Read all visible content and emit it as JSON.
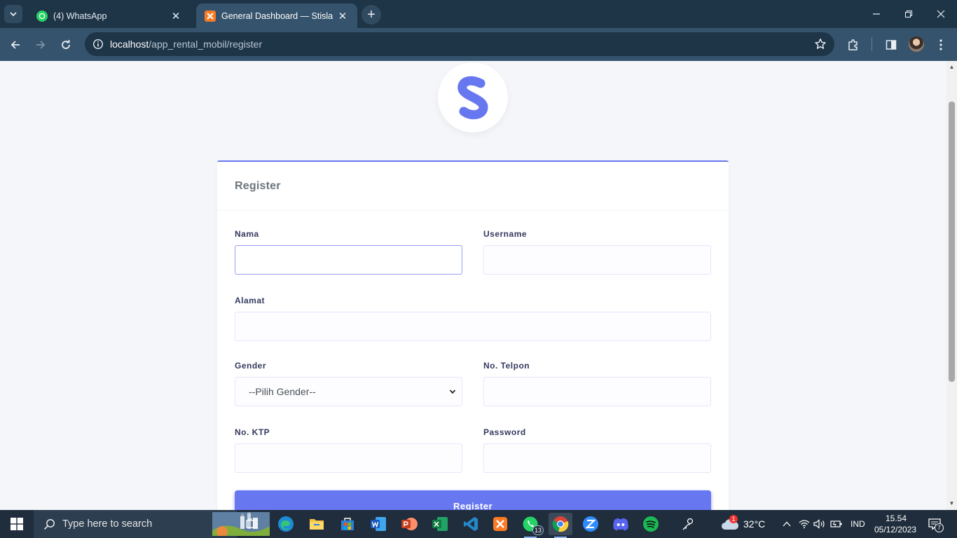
{
  "browser": {
    "tabs": [
      {
        "title": "(4) WhatsApp",
        "favicon": "whatsapp-icon",
        "active": false
      },
      {
        "title": "General Dashboard — Stisla",
        "favicon": "xampp-icon",
        "active": true
      }
    ],
    "address": {
      "host": "localhost",
      "path": "/app_rental_mobil/register"
    }
  },
  "page": {
    "logo_letter": "S",
    "card_title": "Register",
    "form": {
      "nama": {
        "label": "Nama",
        "value": ""
      },
      "username": {
        "label": "Username",
        "value": ""
      },
      "alamat": {
        "label": "Alamat",
        "value": ""
      },
      "gender": {
        "label": "Gender",
        "selected": "--Pilih Gender--"
      },
      "telpon": {
        "label": "No. Telpon",
        "value": ""
      },
      "ktp": {
        "label": "No. KTP",
        "value": ""
      },
      "password": {
        "label": "Password",
        "value": ""
      }
    },
    "submit_label": "Register",
    "accent": "#6777ef"
  },
  "taskbar": {
    "search_placeholder": "Type here to search",
    "apps": [
      {
        "name": "task-view-icon"
      },
      {
        "name": "edge-icon"
      },
      {
        "name": "file-explorer-icon"
      },
      {
        "name": "microsoft-store-icon"
      },
      {
        "name": "word-icon"
      },
      {
        "name": "powerpoint-icon"
      },
      {
        "name": "excel-icon"
      },
      {
        "name": "vscode-icon"
      },
      {
        "name": "xampp-icon"
      },
      {
        "name": "whatsapp-icon",
        "badge": "13"
      },
      {
        "name": "chrome-icon"
      },
      {
        "name": "zoom-icon"
      },
      {
        "name": "discord-icon"
      },
      {
        "name": "spotify-icon"
      },
      {
        "name": "people-icon"
      }
    ],
    "weather": {
      "temp": "32°C",
      "alert_count": "1"
    },
    "language": "IND",
    "time": "15.54",
    "date": "05/12/2023",
    "notifications": "7"
  }
}
